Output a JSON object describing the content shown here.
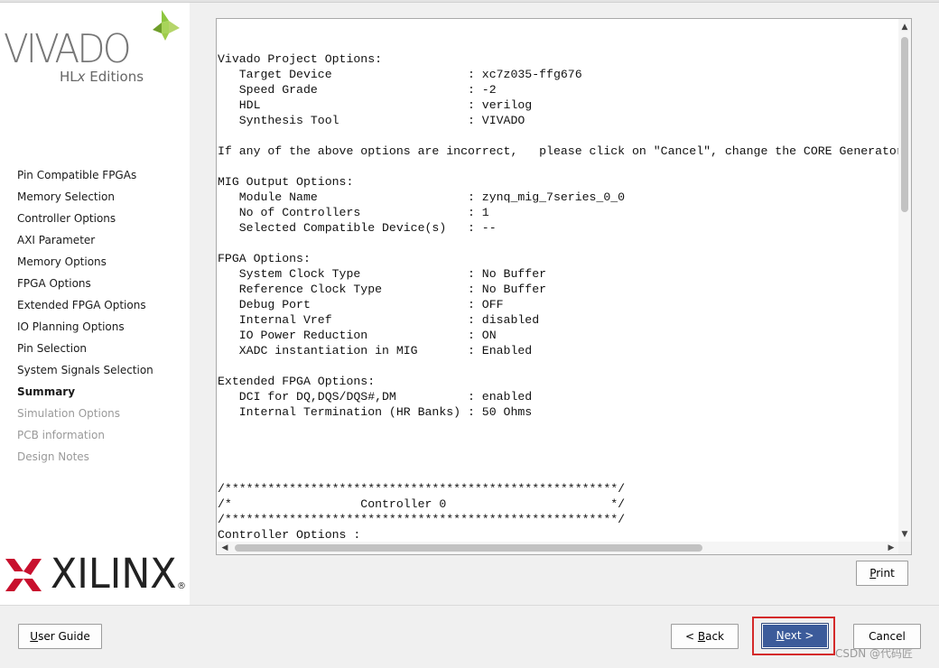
{
  "logos": {
    "vivado": "VIVADO",
    "hlx_prefix": "HL",
    "hlx_x": "x",
    "hlx_suffix": " Editions",
    "xilinx": "XILINX",
    "xilinx_reg": "®"
  },
  "nav": {
    "items": [
      {
        "label": "Pin Compatible FPGAs",
        "state": "normal"
      },
      {
        "label": "Memory Selection",
        "state": "normal"
      },
      {
        "label": "Controller Options",
        "state": "normal"
      },
      {
        "label": "AXI Parameter",
        "state": "normal"
      },
      {
        "label": "Memory Options",
        "state": "normal"
      },
      {
        "label": "FPGA Options",
        "state": "normal"
      },
      {
        "label": "Extended FPGA Options",
        "state": "normal"
      },
      {
        "label": "IO Planning Options",
        "state": "normal"
      },
      {
        "label": "Pin Selection",
        "state": "normal"
      },
      {
        "label": "System Signals Selection",
        "state": "normal"
      },
      {
        "label": "Summary",
        "state": "active"
      },
      {
        "label": "Simulation Options",
        "state": "disabled"
      },
      {
        "label": "PCB information",
        "state": "disabled"
      },
      {
        "label": "Design Notes",
        "state": "disabled"
      }
    ]
  },
  "report": {
    "lines": [
      "Vivado Project Options:",
      "   Target Device                   : xc7z035-ffg676",
      "   Speed Grade                     : -2",
      "   HDL                             : verilog",
      "   Synthesis Tool                  : VIVADO",
      "",
      "If any of the above options are incorrect,   please click on \"Cancel\", change the CORE Generator",
      "",
      "MIG Output Options:",
      "   Module Name                     : zynq_mig_7series_0_0",
      "   No of Controllers               : 1",
      "   Selected Compatible Device(s)   : --",
      "",
      "FPGA Options:",
      "   System Clock Type               : No Buffer",
      "   Reference Clock Type            : No Buffer",
      "   Debug Port                      : OFF",
      "   Internal Vref                   : disabled",
      "   IO Power Reduction              : ON",
      "   XADC instantiation in MIG       : Enabled",
      "",
      "Extended FPGA Options:",
      "   DCI for DQ,DQS/DQS#,DM          : enabled",
      "   Internal Termination (HR Banks) : 50 Ohms",
      "",
      "",
      "",
      "",
      "/*******************************************************/",
      "/*                  Controller 0                       */",
      "/*******************************************************/",
      "Controller Options :"
    ]
  },
  "buttons": {
    "print": {
      "mnemonic": "P",
      "rest": "rint"
    },
    "user_guide": {
      "mnemonic": "U",
      "rest": "ser Guide"
    },
    "back": {
      "prefix": "< ",
      "mnemonic": "B",
      "rest": "ack"
    },
    "next": {
      "mnemonic": "N",
      "rest": "ext >"
    },
    "cancel": "Cancel"
  },
  "colors": {
    "next_button": "#3c5b9a",
    "highlight_box": "#d42a2a",
    "xilinx_red": "#c8102e",
    "vivado_green": "#8dc63f"
  },
  "watermark": "CSDN @代码匠"
}
